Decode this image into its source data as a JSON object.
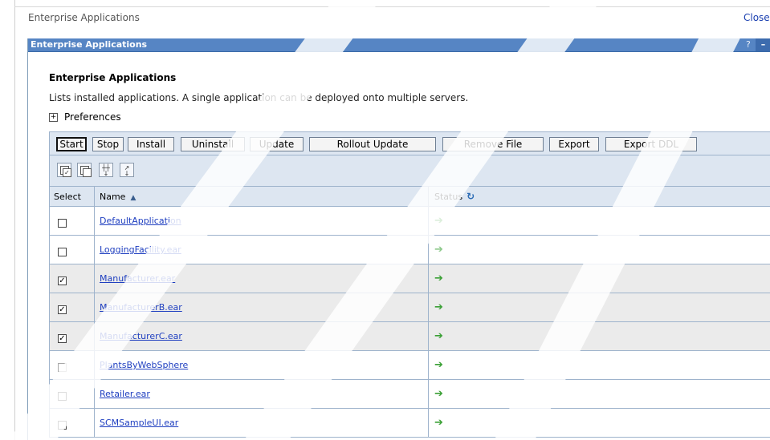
{
  "header": {
    "breadcrumb": "Enterprise Applications",
    "close_label": "Close"
  },
  "portlet": {
    "title": "Enterprise Applications",
    "help_label": "?",
    "minimize_label": "–"
  },
  "content": {
    "title": "Enterprise Applications",
    "description": "Lists installed applications. A single application can be deployed onto multiple servers.",
    "preferences_toggle": "+",
    "preferences_label": "Preferences"
  },
  "toolbar": {
    "buttons": [
      "Start",
      "Stop",
      "Install",
      "Uninstall",
      "Update",
      "Rollout Update",
      "Remove File",
      "Export",
      "Export DDL"
    ]
  },
  "icon_toolbar": {
    "icons": [
      "select-all-icon",
      "deselect-all-icon",
      "show-filter-icon",
      "clear-filter-icon"
    ]
  },
  "table": {
    "columns": {
      "select": "Select",
      "name": "Name",
      "status": "Status"
    },
    "sort_icon": "sort-toggle-icon",
    "status_refresh_icon": "refresh-icon",
    "rows": [
      {
        "name": "DefaultApplication",
        "checked": false,
        "enabled": true,
        "status": "started"
      },
      {
        "name": "LoggingFacility.ear",
        "checked": false,
        "enabled": true,
        "status": "partially-started"
      },
      {
        "name": "Manufacturer.ear",
        "checked": true,
        "enabled": true,
        "status": "started"
      },
      {
        "name": "ManufacturerB.ear",
        "checked": true,
        "enabled": true,
        "status": "started"
      },
      {
        "name": "ManufacturerC.ear",
        "checked": true,
        "enabled": true,
        "status": "started"
      },
      {
        "name": "PlantsByWebSphere",
        "checked": false,
        "enabled": false,
        "status": "started"
      },
      {
        "name": "Retailer.ear",
        "checked": false,
        "enabled": true,
        "status": "started"
      },
      {
        "name": "SCMSampleUI.ear",
        "checked": false,
        "enabled": true,
        "status": "started"
      }
    ]
  },
  "colors": {
    "title_bar": "#5685c4",
    "toolbar_bg": "#dde6f1",
    "link": "#1f3fc0",
    "status_green": "#3aa035"
  }
}
